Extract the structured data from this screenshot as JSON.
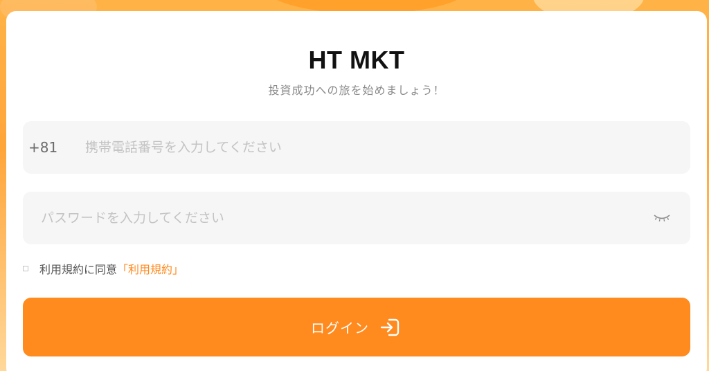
{
  "header": {
    "title": "HT MKT",
    "subtitle": "投資成功への旅を始めましょう！"
  },
  "phone": {
    "country_code": "+81",
    "placeholder": "携帯電話番号を入力してください"
  },
  "password": {
    "placeholder": "パスワードを入力してください",
    "visibility_icon": "eye-closed-icon"
  },
  "terms": {
    "label": "利用規約に同意",
    "link": "「利用規約」"
  },
  "login_button": {
    "label": "ログイン",
    "icon": "login-arrow-icon"
  },
  "colors": {
    "accent": "#ff8a1e",
    "field_background": "#f6f6f6",
    "placeholder": "#c3c3c3"
  }
}
